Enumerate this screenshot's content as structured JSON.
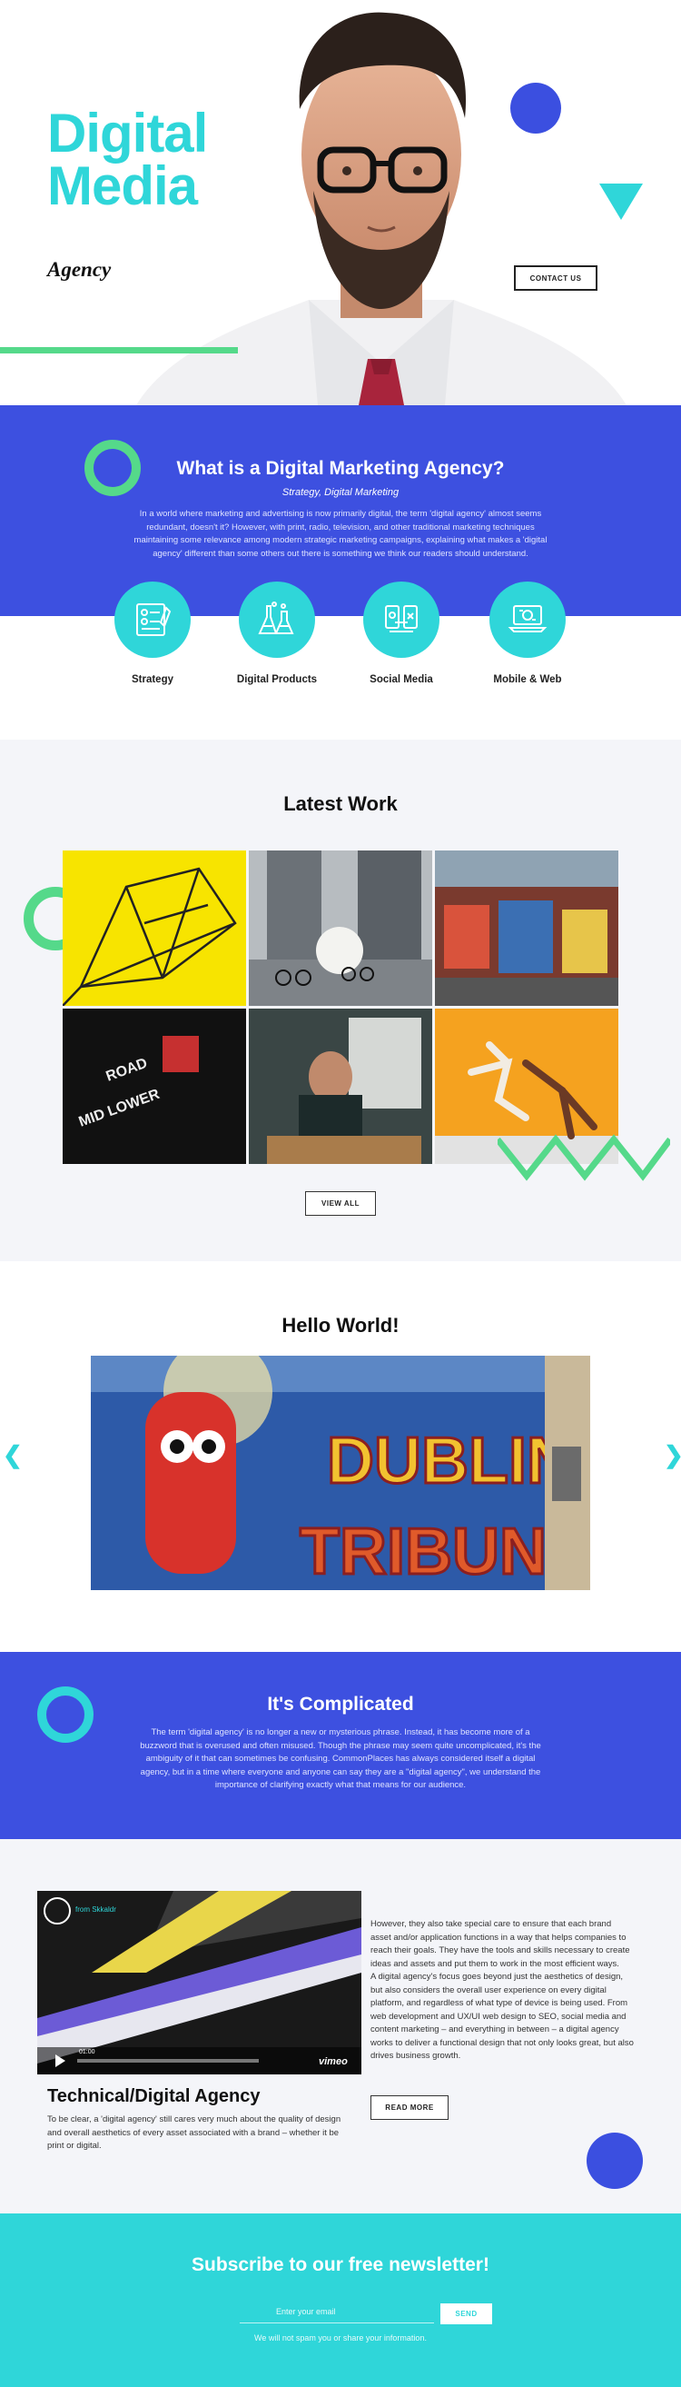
{
  "colors": {
    "cyan": "#2fd6d9",
    "blue": "#3d50e0",
    "green": "#55d98a"
  },
  "hero": {
    "title_line1": "Digital",
    "title_line2": "Media",
    "subtitle": "Agency",
    "contact_label": "CONTACT US"
  },
  "agency": {
    "title": "What is a Digital Marketing Agency?",
    "subtitle": "Strategy, Digital Marketing",
    "body": "In a world where marketing and advertising is now primarily digital, the term 'digital agency' almost seems redundant, doesn't it? However, with print, radio, television, and other traditional marketing techniques maintaining some relevance among modern strategic marketing campaigns, explaining what makes a 'digital agency' different than some others out there is something we think our readers should understand.",
    "services": [
      {
        "label": "Strategy",
        "icon": "strategy-board-icon"
      },
      {
        "label": "Digital Products",
        "icon": "lab-flasks-icon"
      },
      {
        "label": "Social Media",
        "icon": "social-phones-icon"
      },
      {
        "label": "Mobile & Web",
        "icon": "laptop-web-icon"
      }
    ]
  },
  "work": {
    "title": "Latest Work",
    "view_all_label": "VIEW ALL"
  },
  "hello": {
    "title": "Hello World!",
    "prev_icon": "chevron-left-icon",
    "next_icon": "chevron-right-icon"
  },
  "complicated": {
    "title": "It's Complicated",
    "body": "The term 'digital agency' is no longer a new or mysterious phrase. Instead, it has become more of a buzzword that is overused and often misused. Though the phrase may seem quite uncomplicated, it's the ambiguity of it that can sometimes be confusing. CommonPlaces has always considered itself a digital agency, but in a time where everyone and anyone can say they are a \"digital agency\", we understand the importance of clarifying exactly what that means for our audience."
  },
  "technical": {
    "video_channel": "from Skkaldr",
    "video_time": "01:00",
    "video_brand": "vimeo",
    "title": "Technical/Digital Agency",
    "body": "To be clear, a 'digital agency' still cares very much about the quality of design and overall aesthetics of every asset associated with a brand – whether it be print or digital.",
    "right_p1": "However, they also take special care to ensure that each brand asset and/or application functions in a way that helps companies to reach their goals. They have the tools and skills necessary to create ideas and assets and put them to work in the most efficient ways.",
    "right_p2": "A digital agency's focus goes beyond just the aesthetics of design, but also considers the overall user experience on every digital platform, and regardless of what type of device is being used. From web development and UX/UI web design to SEO, social media and content marketing – and everything in between – a digital agency works to deliver a functional design that not only looks great, but also drives business growth.",
    "read_more_label": "READ MORE"
  },
  "newsletter": {
    "title": "Subscribe to our free newsletter!",
    "email_placeholder": "Enter your email",
    "send_label": "SEND",
    "note": "We will not spam you or share your information."
  }
}
